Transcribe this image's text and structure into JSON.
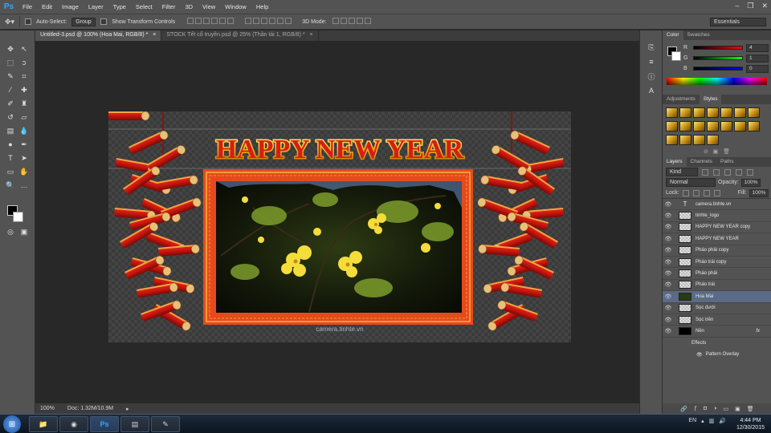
{
  "app": {
    "logo": "Ps"
  },
  "menu": [
    "File",
    "Edit",
    "Image",
    "Layer",
    "Type",
    "Select",
    "Filter",
    "3D",
    "View",
    "Window",
    "Help"
  ],
  "window_controls": {
    "minimize": "–",
    "maximize": "❐",
    "close": "✕"
  },
  "options": {
    "auto_select_label": "Auto-Select:",
    "auto_select_value": "Group",
    "transform_label": "Show Transform Controls",
    "mode_label": "3D Mode:",
    "workspace": "Essentials"
  },
  "tabs": [
    {
      "label": "Untitled-3.psd @ 100% (Hoa Mai, RGB/8) *",
      "close": "×"
    },
    {
      "label": "STOCK Tết cổ truyền.psd @ 25% (Thần tài 1, RGB/8) *",
      "close": "×"
    }
  ],
  "canvas": {
    "title": "HAPPY NEW YEAR",
    "watermark": "camera.tinhte.vn"
  },
  "status": {
    "zoom": "100%",
    "doc": "Doc: 1.32M/10.9M"
  },
  "color_panel": {
    "tabs": [
      "Color",
      "Swatches"
    ],
    "channels": [
      {
        "label": "R",
        "value": "4"
      },
      {
        "label": "G",
        "value": "1"
      },
      {
        "label": "B",
        "value": "0"
      }
    ]
  },
  "styles_panel": {
    "tabs": [
      "Adjustments",
      "Styles"
    ]
  },
  "layers_panel": {
    "tabs": [
      "Layers",
      "Channels",
      "Paths"
    ],
    "filter": "Kind",
    "blend_mode": "Normal",
    "opacity_label": "Opacity:",
    "opacity_value": "100%",
    "lock_label": "Lock:",
    "fill_label": "Fill:",
    "fill_value": "100%",
    "layers": [
      {
        "name": "camera.tinhte.vn"
      },
      {
        "name": "tinhte_logo"
      },
      {
        "name": "HAPPY NEW YEAR copy"
      },
      {
        "name": "HAPPY NEW YEAR"
      },
      {
        "name": "Pháo phải copy"
      },
      {
        "name": "Pháo trái copy"
      },
      {
        "name": "Pháo phải"
      },
      {
        "name": "Pháo trái"
      },
      {
        "name": "Hoa Mai"
      },
      {
        "name": "Sọc dưới"
      },
      {
        "name": "Sọc trên"
      },
      {
        "name": "Nền"
      }
    ],
    "effects_label": "Effects",
    "effect_name": "Pattern Overlay",
    "fx_label": "fx"
  },
  "taskbar": {
    "lang": "EN",
    "time": "4:44 PM",
    "date": "12/30/2015",
    "ps_label": "Ps"
  }
}
